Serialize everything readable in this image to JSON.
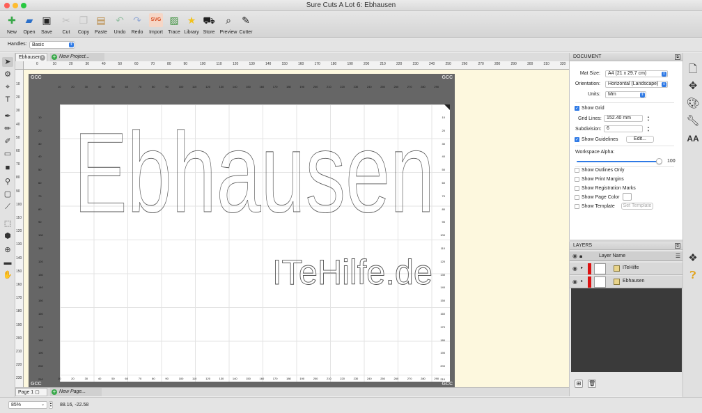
{
  "window": {
    "title": "Sure Cuts A Lot 6: Ebhausen"
  },
  "toolbar": [
    {
      "label": "New",
      "icon": "new-document-icon",
      "glyph": "✚",
      "color": "#3aa84a",
      "enabled": true
    },
    {
      "label": "Open",
      "icon": "folder-open-icon",
      "glyph": "▰",
      "color": "#2a6fc9",
      "enabled": true
    },
    {
      "label": "Save",
      "icon": "floppy-disk-icon",
      "glyph": "▣",
      "color": "#222222",
      "enabled": true
    },
    {
      "label": "Cut",
      "icon": "scissors-icon",
      "glyph": "✂",
      "color": "#999999",
      "enabled": false
    },
    {
      "label": "Copy",
      "icon": "copy-icon",
      "glyph": "❐",
      "color": "#999999",
      "enabled": false
    },
    {
      "label": "Paste",
      "icon": "clipboard-icon",
      "glyph": "▤",
      "color": "#b7843b",
      "enabled": true
    },
    {
      "label": "Undo",
      "icon": "undo-icon",
      "glyph": "↶",
      "color": "#3c9a5a",
      "enabled": false
    },
    {
      "label": "Redo",
      "icon": "redo-icon",
      "glyph": "↷",
      "color": "#3a6ac9",
      "enabled": false
    },
    {
      "label": "Import",
      "icon": "import-svg-icon",
      "glyph": "SVG",
      "color": "#d64a1e",
      "enabled": true
    },
    {
      "label": "Trace",
      "icon": "trace-image-icon",
      "glyph": "▨",
      "color": "#3a8f3a",
      "enabled": true
    },
    {
      "label": "Library",
      "icon": "library-star-icon",
      "glyph": "★",
      "color": "#f2c21b",
      "enabled": true
    },
    {
      "label": "Store",
      "icon": "cart-icon",
      "glyph": "⛟",
      "color": "#222222",
      "enabled": true
    },
    {
      "label": "Preview",
      "icon": "magnifier-preview-icon",
      "glyph": "⌕",
      "color": "#222222",
      "enabled": true
    },
    {
      "label": "Cutter",
      "icon": "blade-cutter-icon",
      "glyph": "✎",
      "color": "#222222",
      "enabled": true
    }
  ],
  "handles": {
    "label": "Handles:",
    "value": "Basic"
  },
  "left_tools": [
    {
      "name": "select-arrow-icon",
      "glyph": "➤",
      "active": true
    },
    {
      "name": "node-edit-icon",
      "glyph": "⚙",
      "active": false
    },
    {
      "name": "crop-select-icon",
      "glyph": "⌖",
      "active": false
    },
    {
      "name": "text-tool-icon",
      "glyph": "T",
      "active": false
    },
    {
      "name": "pen-tool-icon",
      "glyph": "✒",
      "active": false
    },
    {
      "name": "pencil-tool-icon",
      "glyph": "✏",
      "active": false
    },
    {
      "name": "brush-tool-icon",
      "glyph": "✐",
      "active": false
    },
    {
      "name": "eraser-tool-icon",
      "glyph": "▭",
      "active": false
    },
    {
      "name": "rectangle-tool-icon",
      "glyph": "■",
      "active": false
    },
    {
      "name": "eyedropper-tool-icon",
      "glyph": "⚲",
      "active": false
    },
    {
      "name": "shape-fill-icon",
      "glyph": "▢",
      "active": false
    },
    {
      "name": "knife-tool-icon",
      "glyph": "⟋",
      "active": false
    },
    {
      "name": "transform-tool-icon",
      "glyph": "⬚",
      "active": false
    },
    {
      "name": "weld-tool-icon",
      "glyph": "⬢",
      "active": false
    },
    {
      "name": "zoom-tool-icon",
      "glyph": "⊕",
      "active": false
    },
    {
      "name": "measure-tool-icon",
      "glyph": "▬",
      "active": false
    },
    {
      "name": "hand-tool-icon",
      "glyph": "✋",
      "active": false
    }
  ],
  "tabs": {
    "active": "Ebhausen",
    "new": "New Project..."
  },
  "ruler_top": [
    "0",
    "10",
    "20",
    "30",
    "40",
    "50",
    "60",
    "70",
    "80",
    "90",
    "100",
    "110",
    "120",
    "130",
    "140",
    "150",
    "160",
    "170",
    "180",
    "190",
    "200",
    "210",
    "220",
    "230",
    "240",
    "250",
    "260",
    "270",
    "280",
    "290",
    "300",
    "310",
    "320"
  ],
  "ruler_left": [
    "10",
    "20",
    "30",
    "40",
    "50",
    "60",
    "70",
    "80",
    "90",
    "100",
    "110",
    "120",
    "130",
    "140",
    "150",
    "160",
    "170",
    "180",
    "190",
    "200",
    "210",
    "220",
    "230"
  ],
  "mat": {
    "corner": "GCC",
    "top_nums": [
      "10",
      "20",
      "30",
      "40",
      "50",
      "60",
      "70",
      "80",
      "90",
      "100",
      "110",
      "120",
      "130",
      "140",
      "150",
      "160",
      "170",
      "180",
      "190",
      "200",
      "210",
      "220",
      "230",
      "240",
      "250",
      "260",
      "270",
      "280",
      "290"
    ],
    "side_nums": [
      "10",
      "20",
      "30",
      "40",
      "50",
      "60",
      "70",
      "80",
      "90",
      "100",
      "110",
      "120",
      "130",
      "140",
      "150",
      "160",
      "170",
      "180",
      "190",
      "200",
      "210"
    ]
  },
  "design": {
    "title_text": "Ebhausen",
    "sub_text": "ITeHilfe.de"
  },
  "pages": {
    "active": "Page 1",
    "new": "New Page..."
  },
  "status": {
    "zoom": "85%",
    "coords": "88.16, -22.58"
  },
  "document_panel": {
    "header": "DOCUMENT",
    "mat_size_label": "Mat Size:",
    "mat_size_value": "A4 (21 x 29.7 cm)",
    "orientation_label": "Orientation:",
    "orientation_value": "Horizontal (Landscape)",
    "units_label": "Units:",
    "units_value": "Mm",
    "show_grid": "Show Grid",
    "grid_lines_label": "Grid Lines:",
    "grid_lines_value": "152.40 mm",
    "subdivision_label": "Subdivision:",
    "subdivision_value": "6",
    "show_guidelines": "Show Guidelines",
    "edit_button": "Edit...",
    "workspace_alpha_label": "Workspace Alpha:",
    "workspace_alpha_value": "100",
    "workspace_alpha": 1.0,
    "show_outlines_only": "Show Outlines Only",
    "show_print_margins": "Show Print Margins",
    "show_registration_marks": "Show Registration Marks",
    "show_page_color": "Show Page Color",
    "show_template": "Show Template",
    "set_template_button": "Set Template"
  },
  "layers_panel": {
    "header": "LAYERS",
    "column": "Layer Name",
    "layers": [
      {
        "name": "ITeHilfe"
      },
      {
        "name": "Ebhausen"
      }
    ]
  },
  "colors": {
    "accent": "#2f7ae5",
    "workspace": "#fdf8de",
    "mat": "#666666",
    "layer_color": "#dd1111"
  }
}
